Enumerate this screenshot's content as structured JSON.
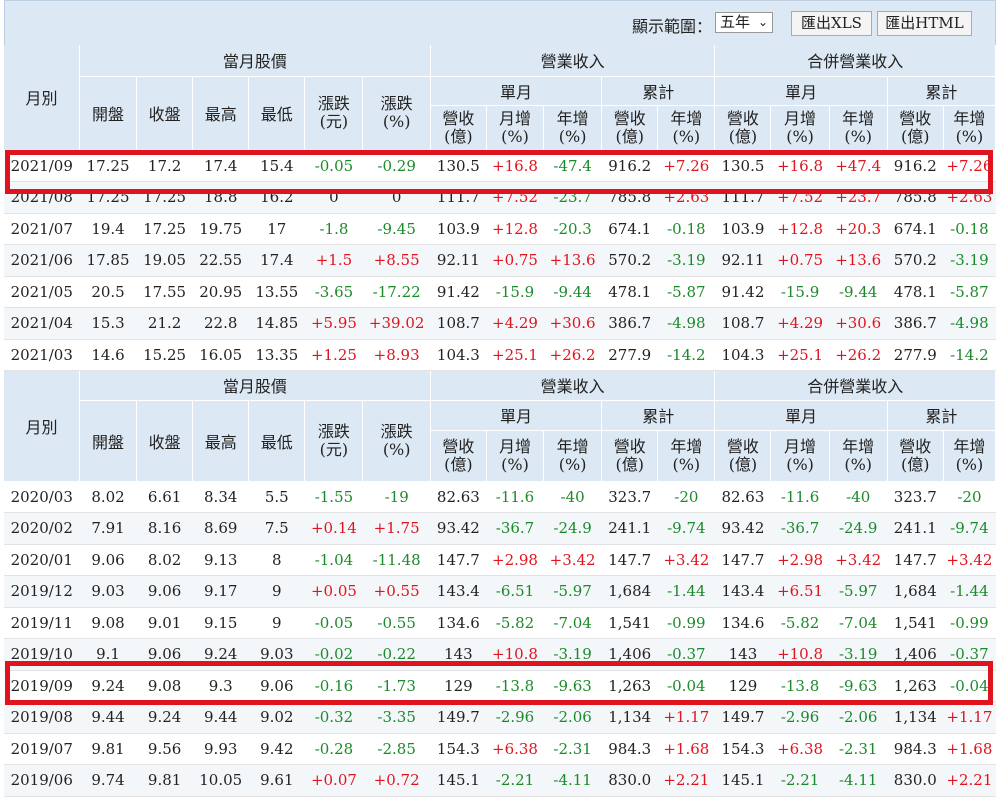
{
  "toolbar": {
    "range_label": "顯示範圍：",
    "range_value": "五年",
    "export_xls": "匯出XLS",
    "export_html": "匯出HTML"
  },
  "headers": {
    "month": "月別",
    "stock_price": "當月股價",
    "revenue": "營業收入",
    "consolidated_revenue": "合併營業收入",
    "single_month": "單月",
    "cumulative": "累計",
    "open": "開盤",
    "close": "收盤",
    "high": "最高",
    "low": "最低",
    "change_yuan": [
      "漲跌",
      "(元)"
    ],
    "change_pct": [
      "漲跌",
      "(%)"
    ],
    "rev_100m": [
      "營收",
      "(億)"
    ],
    "mom_pct": [
      "月增",
      "(%)"
    ],
    "yoy_pct": [
      "年增",
      "(%)"
    ]
  },
  "colors": {
    "positive": "#e0141e",
    "negative": "#1b8a2a",
    "header_bg": "#dce8f3",
    "highlight": "#e0141e"
  },
  "table1_rows": [
    [
      "2021/09",
      "17.25",
      "17.2",
      "17.4",
      "15.4",
      "-0.05",
      "-0.29",
      "130.5",
      "+16.8",
      "-47.4",
      "916.2",
      "+7.26",
      "130.5",
      "+16.8",
      "+47.4",
      "916.2",
      "+7.26"
    ],
    [
      "2021/08",
      "17.25",
      "17.25",
      "18.8",
      "16.2",
      "0",
      "0",
      "111.7",
      "+7.52",
      "-23.7",
      "785.8",
      "+2.63",
      "111.7",
      "+7.52",
      "+23.7",
      "785.8",
      "+2.63"
    ],
    [
      "2021/07",
      "19.4",
      "17.25",
      "19.75",
      "17",
      "-1.8",
      "-9.45",
      "103.9",
      "+12.8",
      "-20.3",
      "674.1",
      "-0.18",
      "103.9",
      "+12.8",
      "+20.3",
      "674.1",
      "-0.18"
    ],
    [
      "2021/06",
      "17.85",
      "19.05",
      "22.55",
      "17.4",
      "+1.5",
      "+8.55",
      "92.11",
      "+0.75",
      "+13.6",
      "570.2",
      "-3.19",
      "92.11",
      "+0.75",
      "+13.6",
      "570.2",
      "-3.19"
    ],
    [
      "2021/05",
      "20.5",
      "17.55",
      "20.95",
      "13.55",
      "-3.65",
      "-17.22",
      "91.42",
      "-15.9",
      "-9.44",
      "478.1",
      "-5.87",
      "91.42",
      "-15.9",
      "-9.44",
      "478.1",
      "-5.87"
    ],
    [
      "2021/04",
      "15.3",
      "21.2",
      "22.8",
      "14.85",
      "+5.95",
      "+39.02",
      "108.7",
      "+4.29",
      "+30.6",
      "386.7",
      "-4.98",
      "108.7",
      "+4.29",
      "+30.6",
      "386.7",
      "-4.98"
    ],
    [
      "2021/03",
      "14.6",
      "15.25",
      "16.05",
      "13.35",
      "+1.25",
      "+8.93",
      "104.3",
      "+25.1",
      "+26.2",
      "277.9",
      "-14.2",
      "104.3",
      "+25.1",
      "+26.2",
      "277.9",
      "-14.2"
    ]
  ],
  "table2_rows": [
    [
      "2020/03",
      "8.02",
      "6.61",
      "8.34",
      "5.5",
      "-1.55",
      "-19",
      "82.63",
      "-11.6",
      "-40",
      "323.7",
      "-20",
      "82.63",
      "-11.6",
      "-40",
      "323.7",
      "-20"
    ],
    [
      "2020/02",
      "7.91",
      "8.16",
      "8.69",
      "7.5",
      "+0.14",
      "+1.75",
      "93.42",
      "-36.7",
      "-24.9",
      "241.1",
      "-9.74",
      "93.42",
      "-36.7",
      "-24.9",
      "241.1",
      "-9.74"
    ],
    [
      "2020/01",
      "9.06",
      "8.02",
      "9.13",
      "8",
      "-1.04",
      "-11.48",
      "147.7",
      "+2.98",
      "+3.42",
      "147.7",
      "+3.42",
      "147.7",
      "+2.98",
      "+3.42",
      "147.7",
      "+3.42"
    ],
    [
      "2019/12",
      "9.03",
      "9.06",
      "9.17",
      "9",
      "+0.05",
      "+0.55",
      "143.4",
      "-6.51",
      "-5.97",
      "1,684",
      "-1.44",
      "143.4",
      "+6.51",
      "-5.97",
      "1,684",
      "-1.44"
    ],
    [
      "2019/11",
      "9.08",
      "9.01",
      "9.15",
      "9",
      "-0.05",
      "-0.55",
      "134.6",
      "-5.82",
      "-7.04",
      "1,541",
      "-0.99",
      "134.6",
      "-5.82",
      "-7.04",
      "1,541",
      "-0.99"
    ],
    [
      "2019/10",
      "9.1",
      "9.06",
      "9.24",
      "9.03",
      "-0.02",
      "-0.22",
      "143",
      "+10.8",
      "-3.19",
      "1,406",
      "-0.37",
      "143",
      "+10.8",
      "-3.19",
      "1,406",
      "-0.37"
    ],
    [
      "2019/09",
      "9.24",
      "9.08",
      "9.3",
      "9.06",
      "-0.16",
      "-1.73",
      "129",
      "-13.8",
      "-9.63",
      "1,263",
      "-0.04",
      "129",
      "-13.8",
      "-9.63",
      "1,263",
      "-0.04"
    ],
    [
      "2019/08",
      "9.44",
      "9.24",
      "9.44",
      "9.02",
      "-0.32",
      "-3.35",
      "149.7",
      "-2.96",
      "-2.06",
      "1,134",
      "+1.17",
      "149.7",
      "-2.96",
      "-2.06",
      "1,134",
      "+1.17"
    ],
    [
      "2019/07",
      "9.81",
      "9.56",
      "9.93",
      "9.42",
      "-0.28",
      "-2.85",
      "154.3",
      "+6.38",
      "-2.31",
      "984.3",
      "+1.68",
      "154.3",
      "+6.38",
      "-2.31",
      "984.3",
      "+1.68"
    ],
    [
      "2019/06",
      "9.74",
      "9.81",
      "10.05",
      "9.61",
      "+0.07",
      "+0.72",
      "145.1",
      "-2.21",
      "-4.11",
      "830.0",
      "+2.21",
      "145.1",
      "-2.21",
      "-4.11",
      "830.0",
      "+2.21"
    ]
  ]
}
